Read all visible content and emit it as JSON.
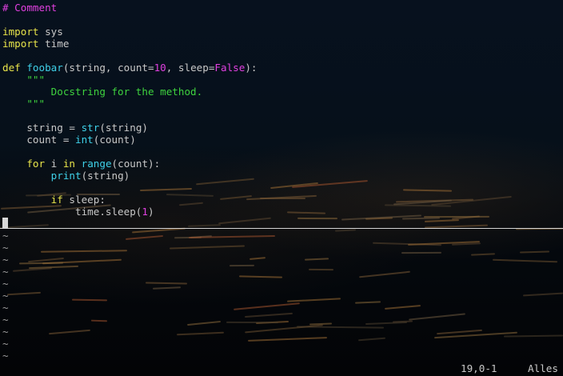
{
  "editor": {
    "lines": [
      [
        {
          "t": "# Comment",
          "c": "comment"
        }
      ],
      [],
      [
        {
          "t": "import",
          "c": "keyword"
        },
        {
          "t": " sys",
          "c": "text"
        }
      ],
      [
        {
          "t": "import",
          "c": "keyword"
        },
        {
          "t": " time",
          "c": "text"
        }
      ],
      [],
      [
        {
          "t": "def",
          "c": "keyword"
        },
        {
          "t": " ",
          "c": "text"
        },
        {
          "t": "foobar",
          "c": "func"
        },
        {
          "t": "(string, count=",
          "c": "text"
        },
        {
          "t": "10",
          "c": "const"
        },
        {
          "t": ", sleep=",
          "c": "text"
        },
        {
          "t": "False",
          "c": "const"
        },
        {
          "t": "):",
          "c": "text"
        }
      ],
      [
        {
          "t": "    ",
          "c": "text"
        },
        {
          "t": "\"\"\"",
          "c": "string"
        }
      ],
      [
        {
          "t": "        Docstring for the method.",
          "c": "string"
        }
      ],
      [
        {
          "t": "    ",
          "c": "text"
        },
        {
          "t": "\"\"\"",
          "c": "string"
        }
      ],
      [],
      [
        {
          "t": "    string = ",
          "c": "text"
        },
        {
          "t": "str",
          "c": "func"
        },
        {
          "t": "(string)",
          "c": "text"
        }
      ],
      [
        {
          "t": "    count = ",
          "c": "text"
        },
        {
          "t": "int",
          "c": "func"
        },
        {
          "t": "(count)",
          "c": "text"
        }
      ],
      [],
      [
        {
          "t": "    ",
          "c": "text"
        },
        {
          "t": "for",
          "c": "keyword"
        },
        {
          "t": " i ",
          "c": "text"
        },
        {
          "t": "in",
          "c": "keyword"
        },
        {
          "t": " ",
          "c": "text"
        },
        {
          "t": "range",
          "c": "func"
        },
        {
          "t": "(count):",
          "c": "text"
        }
      ],
      [
        {
          "t": "        ",
          "c": "text"
        },
        {
          "t": "print",
          "c": "func"
        },
        {
          "t": "(string)",
          "c": "text"
        }
      ],
      [],
      [
        {
          "t": "        ",
          "c": "text"
        },
        {
          "t": "if",
          "c": "keyword"
        },
        {
          "t": " sleep:",
          "c": "text"
        }
      ],
      [
        {
          "t": "            time.sleep(",
          "c": "text"
        },
        {
          "t": "1",
          "c": "const"
        },
        {
          "t": ")",
          "c": "text"
        }
      ]
    ],
    "empty_line_marker": "~",
    "empty_line_count": 11
  },
  "statusbar": {
    "position": "19,0-1",
    "scroll": "Alles"
  },
  "colors": {
    "comment": "#e040e0",
    "keyword": "#e8e44a",
    "function": "#3fd0e8",
    "constant": "#e040e0",
    "string": "#3ed23e",
    "text": "#c8c8c8"
  }
}
